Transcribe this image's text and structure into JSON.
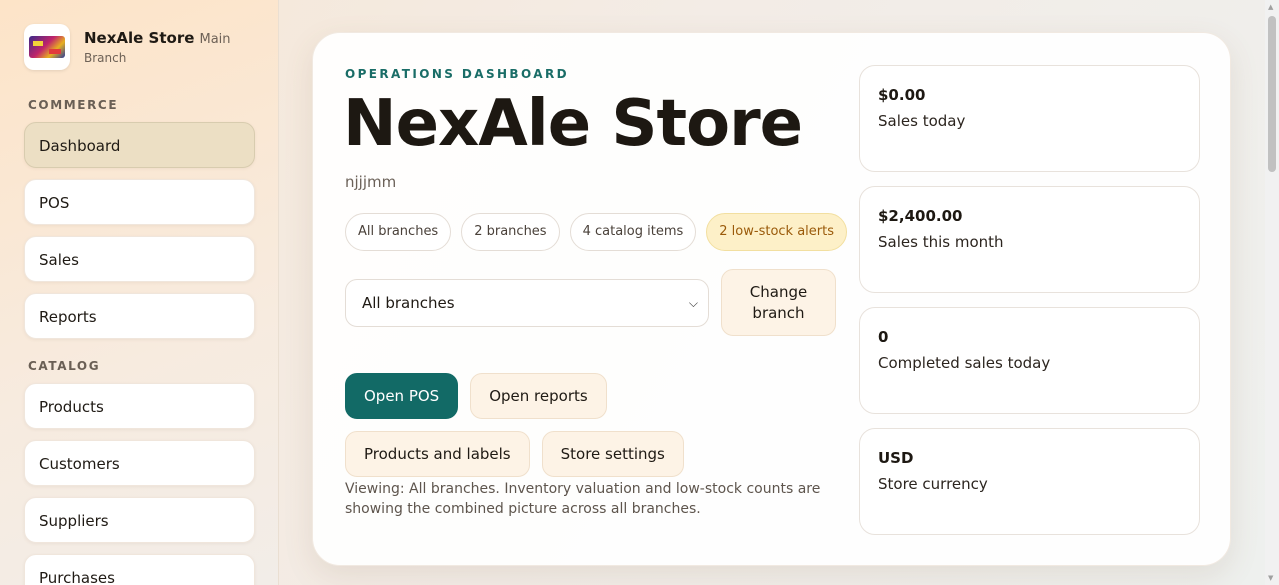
{
  "sidebar": {
    "brand": {
      "name": "NexAle Store",
      "sub_line1": "Main",
      "sub_line2": "Branch"
    },
    "sections": [
      {
        "label": "COMMERCE",
        "items": [
          "Dashboard",
          "POS",
          "Sales",
          "Reports"
        ]
      },
      {
        "label": "CATALOG",
        "items": [
          "Products",
          "Customers",
          "Suppliers",
          "Purchases"
        ]
      }
    ],
    "active_item": "Dashboard"
  },
  "main": {
    "eyebrow": "OPERATIONS DASHBOARD",
    "title": "NexAle Store",
    "subtitle": "njjjmm",
    "chips": [
      "All branches",
      "2 branches",
      "4 catalog items",
      "2 low-stock alerts"
    ],
    "branch_select": {
      "value": "All branches"
    },
    "change_branch_label": "Change branch",
    "actions": [
      "Open POS",
      "Open reports",
      "Products and labels",
      "Store settings"
    ],
    "note": "Viewing: All branches. Inventory valuation and low-stock counts are showing the combined picture across all branches."
  },
  "stats": [
    {
      "value": "$0.00",
      "label": "Sales today"
    },
    {
      "value": "$2,400.00",
      "label": "Sales this month"
    },
    {
      "value": "0",
      "label": "Completed sales today"
    },
    {
      "value": "USD",
      "label": "Store currency"
    }
  ],
  "colors": {
    "accent": "#126a66",
    "alert_bg": "#fdf0c8",
    "alert_text": "#9a5a0a"
  }
}
